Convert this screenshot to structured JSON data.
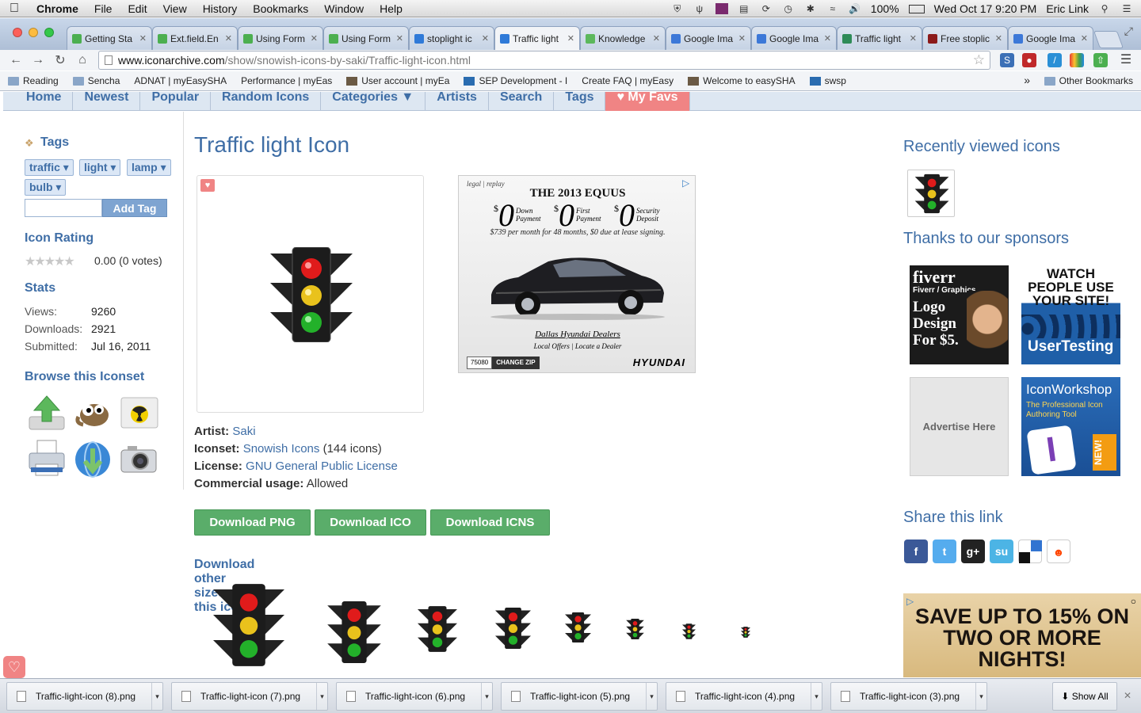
{
  "menubar": {
    "app": "Chrome",
    "menus": [
      "File",
      "Edit",
      "View",
      "History",
      "Bookmarks",
      "Window",
      "Help"
    ],
    "battery": "100%",
    "clock": "Wed Oct 17  9:20 PM",
    "user": "Eric Link"
  },
  "tabs": [
    {
      "title": "Getting Sta",
      "color": "#4caf50"
    },
    {
      "title": "Ext.field.En",
      "color": "#4caf50"
    },
    {
      "title": "Using Form",
      "color": "#4caf50"
    },
    {
      "title": "Using Form",
      "color": "#4caf50"
    },
    {
      "title": "stoplight ic",
      "color": "#2f7ad8"
    },
    {
      "title": "Traffic light",
      "color": "#2f7ad8"
    },
    {
      "title": "Knowledge",
      "color": "#5cb85c"
    },
    {
      "title": "Google Ima",
      "color": "#3c78d8"
    },
    {
      "title": "Google Ima",
      "color": "#3c78d8"
    },
    {
      "title": "Traffic light",
      "color": "#2e8b57"
    },
    {
      "title": "Free stoplic",
      "color": "#8b1a1a"
    },
    {
      "title": "Google Ima",
      "color": "#3c78d8"
    }
  ],
  "omnibox": {
    "host": "www.iconarchive.com",
    "path": "/show/snowish-icons-by-saki/Traffic-light-icon.html"
  },
  "bookmarks": [
    {
      "label": "Reading",
      "kind": "folder"
    },
    {
      "label": "Sencha",
      "kind": "folder"
    },
    {
      "label": "ADNAT | myEasySHA",
      "kind": "page"
    },
    {
      "label": "Performance | myEas",
      "kind": "page"
    },
    {
      "label": "User account | myEa",
      "kind": "img"
    },
    {
      "label": "SEP Development - I",
      "kind": "sep"
    },
    {
      "label": "Create FAQ | myEasy",
      "kind": "page"
    },
    {
      "label": "Welcome to easySHA",
      "kind": "img"
    },
    {
      "label": "swsp",
      "kind": "sep"
    }
  ],
  "other_bookmarks": "Other Bookmarks",
  "sitenav": [
    "Home",
    "Newest",
    "Popular",
    "Random Icons",
    "Categories ▼",
    "Artists",
    "Search",
    "Tags",
    "♥ My Favs"
  ],
  "sidebar": {
    "tags_title": "Tags",
    "tags": [
      "traffic ▾",
      "light ▾",
      "lamp ▾",
      "bulb ▾"
    ],
    "add_tag": "Add Tag",
    "rating_title": "Icon Rating",
    "stars": "★★★★★",
    "rating": "0.00 (0 votes)",
    "stats_title": "Stats",
    "stats": [
      {
        "label": "Views:",
        "value": "9260"
      },
      {
        "label": "Downloads:",
        "value": "2921"
      },
      {
        "label": "Submitted:",
        "value": "Jul 16, 2011"
      }
    ],
    "browse_title": "Browse this Iconset"
  },
  "main": {
    "title": "Traffic light Icon",
    "meta": [
      {
        "label": "Artist:",
        "value": "Saki",
        "link": true,
        "suffix": ""
      },
      {
        "label": "Iconset:",
        "value": "Snowish Icons",
        "link": true,
        "suffix": " (144 icons)"
      },
      {
        "label": "License:",
        "value": "GNU General Public License",
        "link": true,
        "suffix": ""
      },
      {
        "label": "Commercial usage:",
        "value": "Allowed",
        "link": false,
        "suffix": ""
      }
    ],
    "buttons": [
      "Download PNG",
      "Download ICO",
      "Download ICNS"
    ],
    "sizes_title": "Download other sizes of this icon:"
  },
  "ad": {
    "legal": "legal | replay",
    "headline": "THE 2013 EQUUS",
    "offers": [
      {
        "amount": "0",
        "label": "Down Payment"
      },
      {
        "amount": "0",
        "label": "First Payment"
      },
      {
        "amount": "0",
        "label": "Security Deposit"
      }
    ],
    "terms": "$739 per month for 48 months, $0 due at lease signing.",
    "dealer": "Dallas Hyundai Dealers",
    "links": "Local Offers  |  Locate a Dealer",
    "zip": "75080",
    "change_zip": "CHANGE ZIP",
    "brand": "HYUNDAI"
  },
  "right": {
    "recent_title": "Recently viewed icons",
    "sponsors_title": "Thanks to our sponsors",
    "fiverr": {
      "brand": "fiverr",
      "sub": "Fiverr / Graphics",
      "text": "Logo Design For $5."
    },
    "usertesting": {
      "top": "WATCH PEOPLE USE YOUR SITE!",
      "brand": "UserTesting"
    },
    "advertise": "Advertise Here",
    "iconworkshop": {
      "brand": "IconWorkshop",
      "sub": "The Professional Icon Authoring Tool",
      "badge": "NEW!"
    },
    "share_title": "Share this link",
    "ad2_text": "SAVE UP TO 15% ON TWO OR MORE NIGHTS!"
  },
  "downloads": [
    "Traffic-light-icon (8).png",
    "Traffic-light-icon (7).png",
    "Traffic-light-icon (6).png",
    "Traffic-light-icon (5).png",
    "Traffic-light-icon (4).png",
    "Traffic-light-icon (3).png"
  ],
  "show_all": "Show All"
}
